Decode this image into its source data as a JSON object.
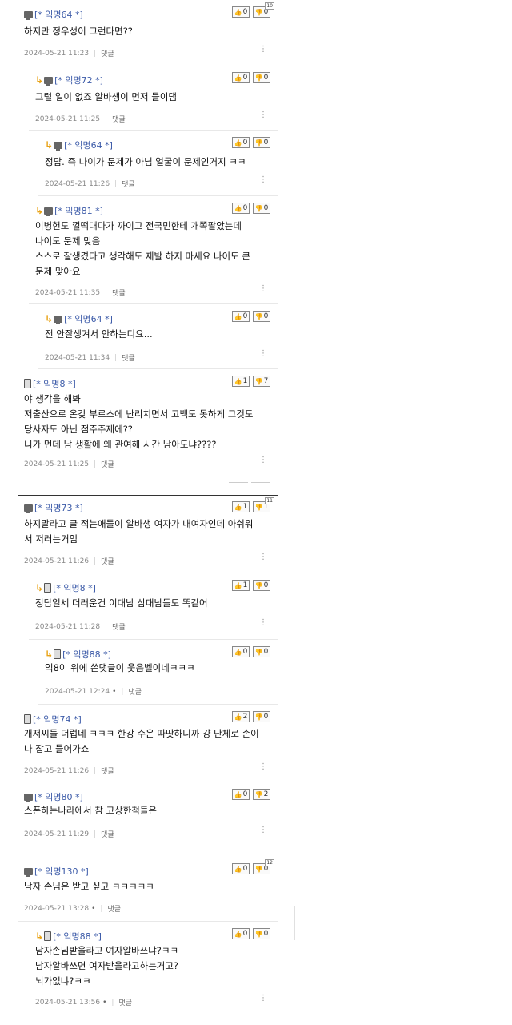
{
  "reply_label": "댓글",
  "more_icon": "vertical-dots-icon",
  "comments": [
    {
      "author": "[* 익명64 *]",
      "device": "pc",
      "text": [
        "하지만 정우성이 그런다면??"
      ],
      "time": "2024-05-21 11:23",
      "up": "0",
      "down": "0",
      "down_badge": "10"
    },
    {
      "author": "[* 익명72 *]",
      "device": "pc",
      "text": [
        "그럴 일이 없죠 알바생이 먼저 들이댐"
      ],
      "time": "2024-05-21 11:25",
      "up": "0",
      "down": "0"
    },
    {
      "author": "[* 익명64 *]",
      "device": "pc",
      "text": [
        "정답. 즉 나이가 문제가 아님 얼굴이 문제인거지 ㅋㅋ"
      ],
      "time": "2024-05-21 11:26",
      "up": "0",
      "down": "0"
    },
    {
      "author": "[* 익명81 *]",
      "device": "pc",
      "text": [
        "이병헌도 껄떡대다가 까이고 전국민한테 개쪽팔았는데",
        "나이도 문제 맞음",
        "스스로 잘생겼다고 생각해도 제발 하지 마세요 나이도 큰",
        "문제 맞아요"
      ],
      "time": "2024-05-21 11:35",
      "up": "0",
      "down": "0"
    },
    {
      "author": "[* 익명64 *]",
      "device": "pc",
      "text": [
        "전 안잘생겨서 안하는디요..."
      ],
      "time": "2024-05-21 11:34",
      "up": "0",
      "down": "0"
    },
    {
      "author": "[* 익명8 *]",
      "device": "mobile",
      "text": [
        "야 생각을 해봐",
        "저출산으로 온갖 부르스에 난리치면서 고백도 못하게 그것도",
        "당사자도 아닌 점주주제에??",
        "니가 먼데 남 생활에 왜 관여해 시간 남아도냐????"
      ],
      "time": "2024-05-21 11:25",
      "up": "1",
      "down": "7"
    },
    {
      "author": "[* 익명73 *]",
      "device": "pc",
      "text": [
        "하지말라고 글 적는애들이 알바생 여자가 내여자인데 아쉬워",
        "서 저러는거임"
      ],
      "time": "2024-05-21 11:26",
      "up": "1",
      "down": "1",
      "down_badge": "11"
    },
    {
      "author": "[* 익명8 *]",
      "device": "mobile",
      "text": [
        "정답일세 더러운건 이대남 삼대남들도 똑같어"
      ],
      "time": "2024-05-21 11:28",
      "up": "1",
      "down": "0"
    },
    {
      "author": "[* 익명88 *]",
      "device": "mobile",
      "text": [
        "익8이 위에 쓴댓글이 웃음벨이네ㅋㅋㅋ"
      ],
      "time": "2024-05-21 12:24",
      "up": "0",
      "down": "0",
      "time_dot": "•"
    },
    {
      "author": "[* 익명74 *]",
      "device": "mobile",
      "text": [
        "개저씨들 더럽네 ㅋㅋㅋ 한강 수온 따땃하니까 걍 단체로 손이",
        "나 잡고 들어가쇼"
      ],
      "time": "2024-05-21 11:26",
      "up": "2",
      "down": "0"
    },
    {
      "author": "[* 익명80 *]",
      "device": "pc",
      "text": [
        "스폰하는나라에서 참 고상한척들은"
      ],
      "time": "2024-05-21 11:29",
      "up": "0",
      "down": "2"
    },
    {
      "author": "[* 익명130 *]",
      "device": "pc",
      "text": [
        "남자 손님은 받고 싶고 ㅋㅋㅋㅋㅋ"
      ],
      "time": "2024-05-21 13:28",
      "up": "0",
      "down": "0",
      "down_badge": "12",
      "time_dot": "•"
    },
    {
      "author": "[* 익명88 *]",
      "device": "mobile",
      "text": [
        "남자손님받을라고 여자알바쓰냐?ㅋㅋ",
        "남자알바쓰면 여자받을라고하는거고?",
        "뇌가없냐?ㅋㅋ"
      ],
      "time": "2024-05-21 13:56",
      "up": "0",
      "down": "0",
      "time_dot": "•"
    }
  ]
}
